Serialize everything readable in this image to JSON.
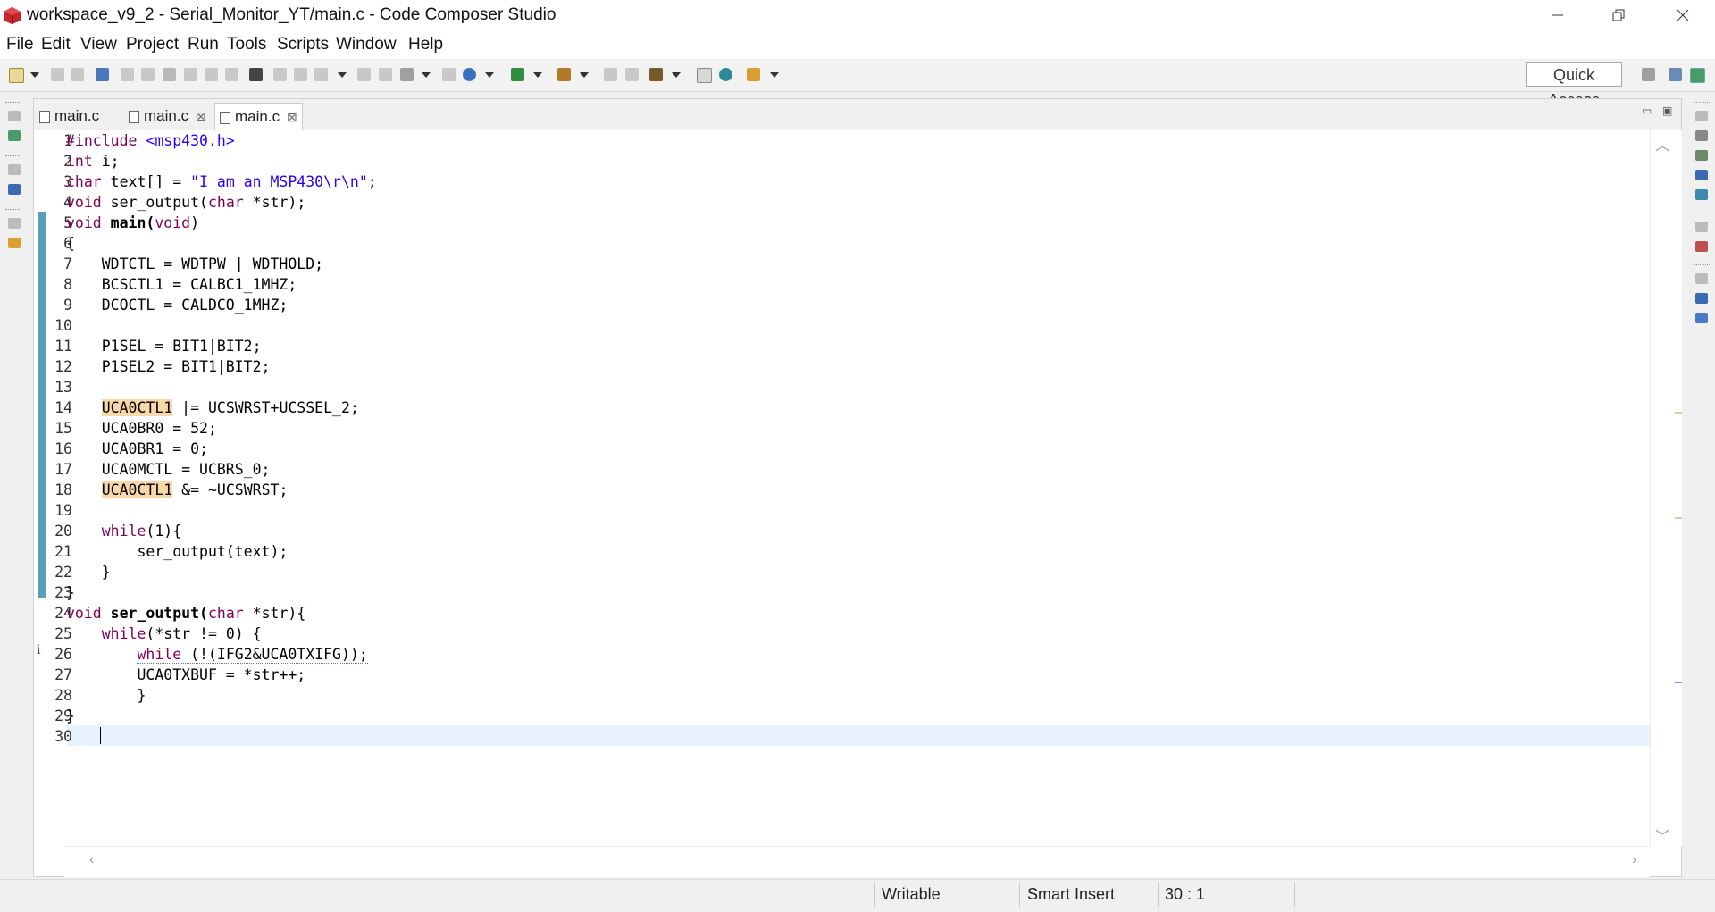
{
  "window": {
    "title": "workspace_v9_2 - Serial_Monitor_YT/main.c - Code Composer Studio",
    "minimize": "—",
    "restore": "❐",
    "close": "✕"
  },
  "menu": [
    "File",
    "Edit",
    "View",
    "Project",
    "Run",
    "Tools",
    "Scripts",
    "Window",
    "Help"
  ],
  "quick_access": "Quick Access",
  "tabs": [
    {
      "label": "main.c",
      "close": ""
    },
    {
      "label": "main.c",
      "close": "⊠"
    },
    {
      "label": "main.c",
      "close": "⊠"
    }
  ],
  "pane_controls": {
    "minimize": "▭",
    "maximize": "▣"
  },
  "line_numbers": [
    "1",
    "2",
    "3",
    "4",
    "5",
    "6",
    "7",
    "8",
    "9",
    "10",
    "11",
    "12",
    "13",
    "14",
    "15",
    "16",
    "17",
    "18",
    "19",
    "20",
    "21",
    "22",
    "23",
    "24",
    "25",
    "26",
    "27",
    "28",
    "29",
    "30"
  ],
  "code": {
    "l1a": "#include ",
    "l1b": "<msp430.h>",
    "l2a": "int",
    "l2b": " i;",
    "l3a": "char",
    "l3b": " text[] = ",
    "l3c": "\"I am an MSP430\\r\\n\"",
    "l3d": ";",
    "l4a": "void",
    "l4b": " ser_output(",
    "l4c": "char",
    "l4d": " *str);",
    "l5a": "void",
    "l5b": " main(",
    "l5c": "void",
    "l5d": ")",
    "l6": "{",
    "l7": "    WDTCTL = WDTPW | WDTHOLD;",
    "l8": "    BCSCTL1 = CALBC1_1MHZ;",
    "l9": "    DCOCTL = CALDCO_1MHZ;",
    "l10": "",
    "l11": "    P1SEL = BIT1|BIT2;",
    "l12": "    P1SEL2 = BIT1|BIT2;",
    "l13": "",
    "l14a": "    ",
    "l14b": "UCA0CTL1",
    "l14c": " |= UCSWRST+UCSSEL_2;",
    "l15": "    UCA0BR0 = 52;",
    "l16": "    UCA0BR1 = 0;",
    "l17": "    UCA0MCTL = UCBRS_0;",
    "l18a": "    ",
    "l18b": "UCA0CTL1",
    "l18c": " &= ~UCSWRST;",
    "l19": "",
    "l20a": "    ",
    "l20b": "while",
    "l20c": "(1){",
    "l21": "        ser_output(text);",
    "l22": "    }",
    "l23": "}",
    "l24a": "void",
    "l24b": " ser_output(",
    "l24c": "char",
    "l24d": " *str){",
    "l25a": "    ",
    "l25b": "while",
    "l25c": "(*str != 0) {",
    "l26a": "        ",
    "l26b": "while",
    "l26c": " (!(IFG2&UCA0TXIFG));",
    "l27": "        UCA0TXBUF = *str++;",
    "l28": "        }",
    "l29": "}",
    "l30": ""
  },
  "info_marker": "i",
  "status": {
    "writable": "Writable",
    "insert_mode": "Smart Insert",
    "position": "30 : 1"
  },
  "colors": {
    "keyword": "#7f0055",
    "string": "#2a00ff",
    "highlight": "#f8d7a8",
    "current_line": "#e8f2fe",
    "ruler": "#5a9fb5",
    "logo": "#c4262e"
  },
  "icons": [
    "app-logo-icon",
    "new-icon",
    "save-icon",
    "save-all-icon",
    "debug-icon",
    "resume-icon",
    "suspend-icon",
    "terminate-icon",
    "step-into-icon",
    "step-over-icon",
    "step-return-icon",
    "memory-icon",
    "build-icon",
    "search-icon",
    "open-perspective-icon"
  ]
}
